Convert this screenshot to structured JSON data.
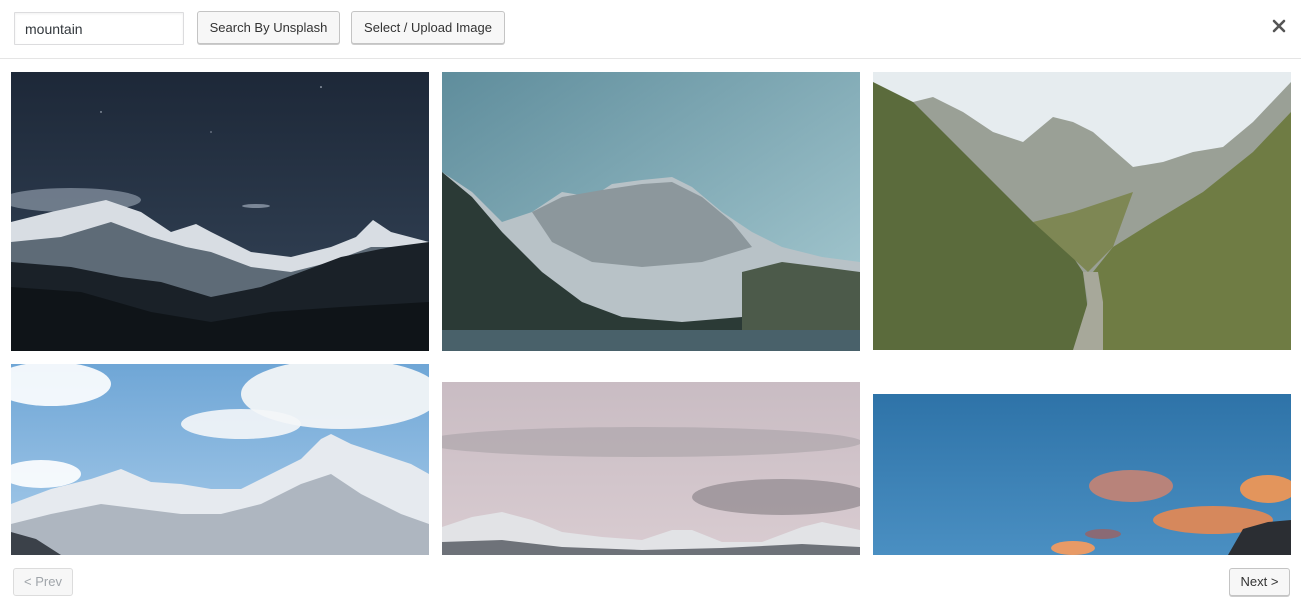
{
  "search": {
    "value": "mountain",
    "search_button_label": "Search By Unsplash",
    "upload_button_label": "Select / Upload Image"
  },
  "close_icon": "close-icon",
  "photos": [
    {
      "name": "photo-night-snowy-peaks"
    },
    {
      "name": "photo-lake-mountain"
    },
    {
      "name": "photo-green-valley"
    },
    {
      "name": "photo-snowy-peaks-blue-sky"
    },
    {
      "name": "photo-pink-cloudy-peaks"
    },
    {
      "name": "photo-blue-sky-orange-clouds"
    }
  ],
  "pagination": {
    "prev_label": "< Prev",
    "next_label": "Next >"
  }
}
